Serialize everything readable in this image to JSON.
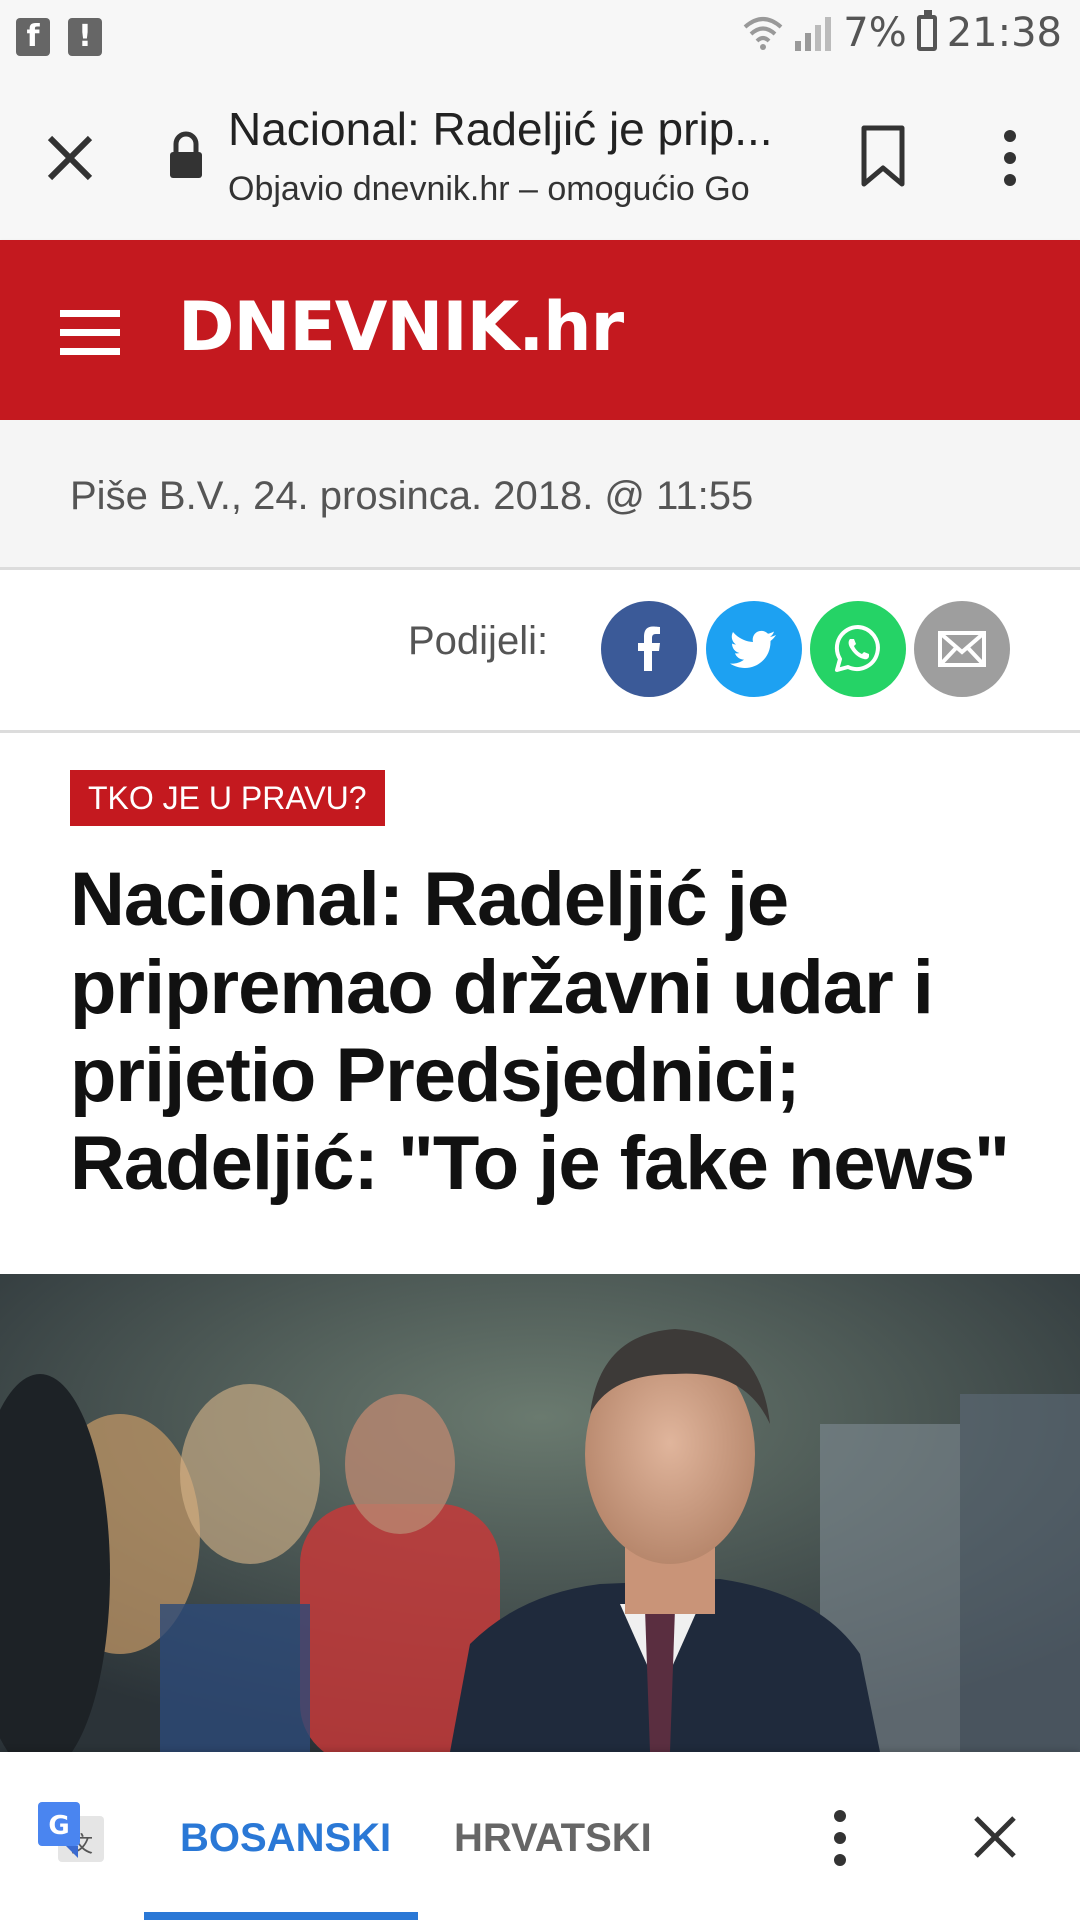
{
  "status_bar": {
    "battery": "7%",
    "time": "21:38",
    "icons": [
      "facebook-notification-icon",
      "alert-notification-icon",
      "wifi-icon",
      "signal-icon",
      "battery-icon"
    ]
  },
  "toolbar": {
    "page_title": "Nacional: Radeljić je prip...",
    "page_subtitle": "Objavio dnevnik.hr – omogućio Go"
  },
  "site": {
    "logo": "DNEVNIK.hr",
    "brand_color": "#c4191f"
  },
  "article": {
    "byline": "Piše B.V., 24. prosinca. 2018. @ 11:55",
    "share_label": "Podijeli:",
    "tag": "TKO JE U PRAVU?",
    "headline": "Nacional: Radeljić je pripremao državni udar i prijetio Predsjednici; Radeljić: \"To je fake news\""
  },
  "share_buttons": [
    {
      "name": "facebook",
      "color": "#3b5a98"
    },
    {
      "name": "twitter",
      "color": "#1da1f2"
    },
    {
      "name": "whatsapp",
      "color": "#25d366"
    },
    {
      "name": "email",
      "color": "#9e9e9e"
    }
  ],
  "translate_bar": {
    "active_language": "BOSANSKI",
    "other_language": "HRVATSKI",
    "accent": "#2a78d6"
  }
}
